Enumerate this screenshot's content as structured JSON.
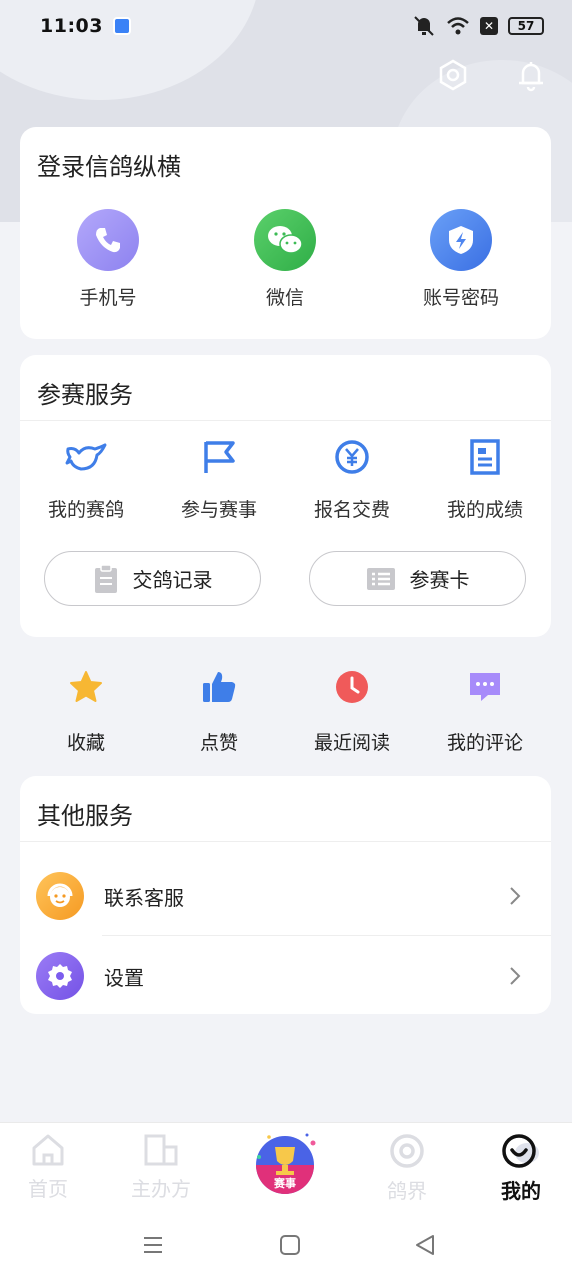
{
  "status_bar": {
    "time": "11:03",
    "battery": "57"
  },
  "login": {
    "title": "登录信鸽纵横",
    "options": [
      {
        "label": "手机号",
        "icon": "phone-icon"
      },
      {
        "label": "微信",
        "icon": "wechat-icon"
      },
      {
        "label": "账号密码",
        "icon": "shield-icon"
      }
    ]
  },
  "competition": {
    "title": "参赛服务",
    "items": [
      {
        "label": "我的赛鸽",
        "icon": "pigeon-icon"
      },
      {
        "label": "参与赛事",
        "icon": "flag-icon"
      },
      {
        "label": "报名交费",
        "icon": "yen-coin-icon"
      },
      {
        "label": "我的成绩",
        "icon": "document-icon"
      }
    ],
    "buttons": [
      {
        "label": "交鸽记录",
        "icon": "clipboard-icon"
      },
      {
        "label": "参赛卡",
        "icon": "list-card-icon"
      }
    ]
  },
  "quick": {
    "items": [
      {
        "label": "收藏",
        "icon": "star-icon"
      },
      {
        "label": "点赞",
        "icon": "thumbs-up-icon"
      },
      {
        "label": "最近阅读",
        "icon": "clock-icon"
      },
      {
        "label": "我的评论",
        "icon": "comment-icon"
      }
    ]
  },
  "other": {
    "title": "其他服务",
    "items": [
      {
        "label": "联系客服",
        "icon": "customer-service-icon"
      },
      {
        "label": "设置",
        "icon": "settings-gear-icon"
      }
    ]
  },
  "bottom_nav": {
    "items": [
      {
        "label": "首页",
        "icon": "home-icon"
      },
      {
        "label": "主办方",
        "icon": "building-icon"
      },
      {
        "label": "赛事",
        "icon": "trophy-icon"
      },
      {
        "label": "鸽界",
        "icon": "circle-icon"
      },
      {
        "label": "我的",
        "icon": "smile-icon"
      }
    ],
    "active": "我的"
  },
  "colors": {
    "accent_blue": "#3f7ee8",
    "phone_purple": "#9b8cf5",
    "wechat_green": "#3dbb55",
    "shield_blue": "#4f86f0"
  }
}
